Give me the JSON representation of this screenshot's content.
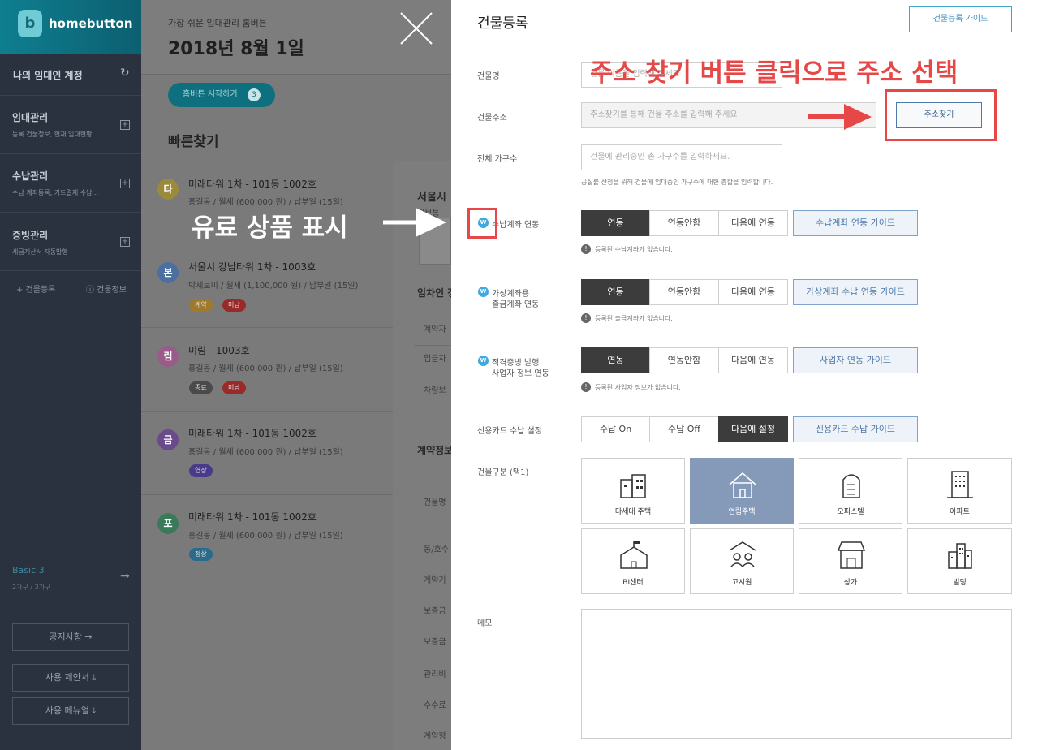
{
  "sidebar": {
    "logo_letter": "b",
    "logo_text": "homebutton",
    "account_label": "나의 임대인 계정",
    "sections": [
      {
        "title": "임대관리",
        "desc": "등록 건물정보, 현재 임대현황..."
      },
      {
        "title": "수납관리",
        "desc": "수납 계좌등록, 카드결제 수납..."
      },
      {
        "title": "증빙관리",
        "desc": "세금계산서 자동발행"
      }
    ],
    "add_building": "+ 건물등록",
    "building_info": "ⓘ 건물정보",
    "plan_name": "Basic 3",
    "plan_usage": "2가구 / 3가구",
    "notice_btn": "공지사항 →",
    "proposal_btn": "사용 제안서 ⤓",
    "manual_btn": "사용 메뉴얼 ⤓"
  },
  "middle": {
    "subtitle": "가장 쉬운 임대관리 홈버튼",
    "date": "2018년 8월 1일",
    "start_btn": "홈버튼 시작하기",
    "start_badge": "3",
    "quick_title": "빠른찾기",
    "items": [
      {
        "avatar": "타",
        "title": "미래타워 1차 - 101동 1002호",
        "sub": "홍길동 / 월세 (600,000 원) / 납부일 (15일)",
        "tags": []
      },
      {
        "avatar": "본",
        "title": "서울시 강남타워 1차 - 1003호",
        "sub": "박세로미 / 월세 (1,100,000 원) / 납부일 (15일)",
        "tags": [
          "계약",
          "미납"
        ]
      },
      {
        "avatar": "림",
        "title": "미림 - 1003호",
        "sub": "홍길동 / 월세 (600,000 원) / 납부일 (15일)",
        "tags": [
          "종료",
          "미납"
        ]
      },
      {
        "avatar": "금",
        "title": "미래타워 1차 - 101동 1002호",
        "sub": "홍길동 / 월세 (600,000 원) / 납부일 (15일)",
        "tags": [
          "연장"
        ]
      },
      {
        "avatar": "포",
        "title": "미래타워 1차 - 101동 1002호",
        "sub": "홍길동 / 월세 (600,000 원) / 납부일 (15일)",
        "tags": [
          "정상"
        ]
      }
    ],
    "peek_title": "서울시",
    "peek_sub": "정보통",
    "peek_tenant": "임차인 정",
    "peek_rows": [
      "계약자",
      "입금자",
      "차량보"
    ],
    "peek_contract": "계약정보",
    "peek_rows2": [
      "건물명",
      "동/호수",
      "계약기",
      "보증금",
      "보증금",
      "관리비",
      "수수료",
      "계약형"
    ]
  },
  "modal": {
    "title": "건물등록",
    "guide_btn": "건물등록 가이드",
    "name_label": "건물명",
    "name_placeholder": "건물 이름을 입력해 주세요",
    "address_label": "건물주소",
    "address_placeholder": "주소찾기를 통해 건물 주소를 입력해 주세요",
    "address_btn": "주소찾기",
    "units_label": "전체 가구수",
    "units_placeholder": "건물에 관리중인 총 가구수를 입력하세요.",
    "units_note": "공실률 산정을 위해 건물에 임대중인 가구수에 대한 총합을 입력합니다.",
    "w_icon": "W",
    "account_label": "수납계좌 연동",
    "account_options": [
      "연동",
      "연동안함",
      "다음에 연동"
    ],
    "account_guide": "수납계좌 연동 가이드",
    "account_note": "등록된 수납계좌가 없습니다.",
    "virtual_label_1": "가상계좌용",
    "virtual_label_2": "출금계좌 연동",
    "virtual_options": [
      "연동",
      "연동안함",
      "다음에 연동"
    ],
    "virtual_guide": "가상계좌 수납 연동 가이드",
    "virtual_note": "등록된 출금계좌가 없습니다.",
    "biz_label_1": "적격증빙 발행",
    "biz_label_2": "사업자 정보 연동",
    "biz_options": [
      "연동",
      "연동안함",
      "다음에 연동"
    ],
    "biz_guide": "사업자 연동 가이드",
    "biz_note": "등록된 사업자 정보가 없습니다.",
    "card_label": "신용카드 수납 설정",
    "card_options": [
      "수납 On",
      "수납 Off",
      "다음에 설정"
    ],
    "card_guide": "신용카드 수납 가이드",
    "type_label": "건물구분 (택1)",
    "types": [
      "다세대 주택",
      "연립주택",
      "오피스텔",
      "아파트",
      "BI센터",
      "고시원",
      "상가",
      "빌딩"
    ],
    "memo_label": "메모"
  },
  "annotations": {
    "red_text": "주소 찾기 버튼 클릭으로 주소 선택",
    "white_text": "유료 상품 표시",
    "red_color": "#e64848"
  }
}
